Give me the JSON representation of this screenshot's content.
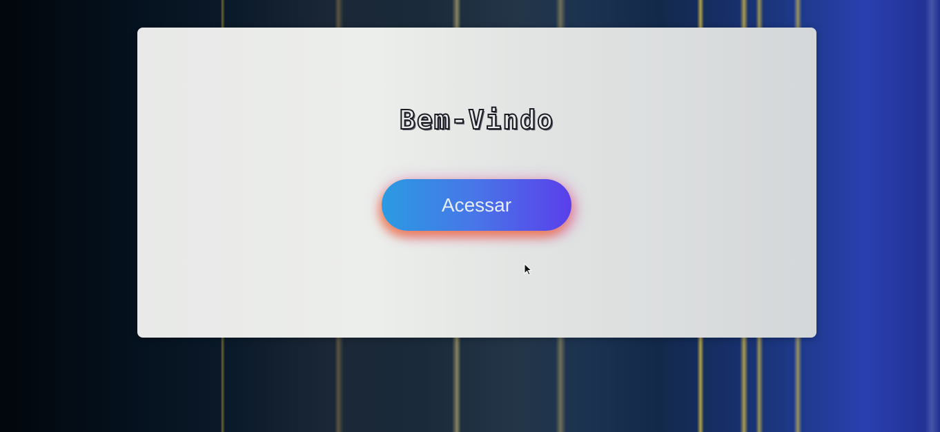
{
  "card": {
    "title": "Bem-Vindo",
    "access_button_label": "Acessar"
  },
  "colors": {
    "button_gradient_start": "#2a9be2",
    "button_gradient_end": "#5a3fea",
    "card_background": "#e8e9e8"
  },
  "icons": {
    "cursor": "mouse-pointer-icon"
  }
}
